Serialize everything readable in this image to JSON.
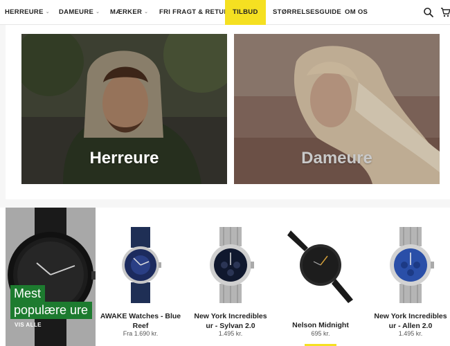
{
  "nav": {
    "items": [
      {
        "label": "HERREURE",
        "chevron": true
      },
      {
        "label": "DAMEURE",
        "chevron": true
      },
      {
        "label": "MÆRKER",
        "chevron": true
      },
      {
        "label": "FRI FRAGT & RETUR",
        "chevron": false
      },
      {
        "label": "TILBUD",
        "chevron": false
      },
      {
        "label": "STØRRELSESGUIDE",
        "chevron": false
      },
      {
        "label": "OM OS",
        "chevron": false
      }
    ],
    "chevron_glyph": "⌄",
    "icons": [
      "search-icon",
      "cart-icon"
    ]
  },
  "hero": {
    "men_label": "Herreure",
    "women_label": "Dameure"
  },
  "promo": {
    "title_line1": "Mest",
    "title_line2": "populære ure",
    "link": "VIS ALLE"
  },
  "products": [
    {
      "name_line1": "AWAKE Watches - Blue",
      "name_line2": "Reef",
      "price": "Fra 1.690 kr."
    },
    {
      "name_line1": "New York Incredibles",
      "name_line2": "ur - Sylvan 2.0",
      "price": "1.495 kr."
    },
    {
      "name_line1": "Nelson Midnight",
      "name_line2": "",
      "price": "695 kr."
    },
    {
      "name_line1": "New York Incredibles",
      "name_line2": "ur - Allen 2.0",
      "price": "1.495 kr."
    }
  ],
  "colors": {
    "highlight": "#f5e021",
    "promo_green": "#1d7b2f"
  }
}
